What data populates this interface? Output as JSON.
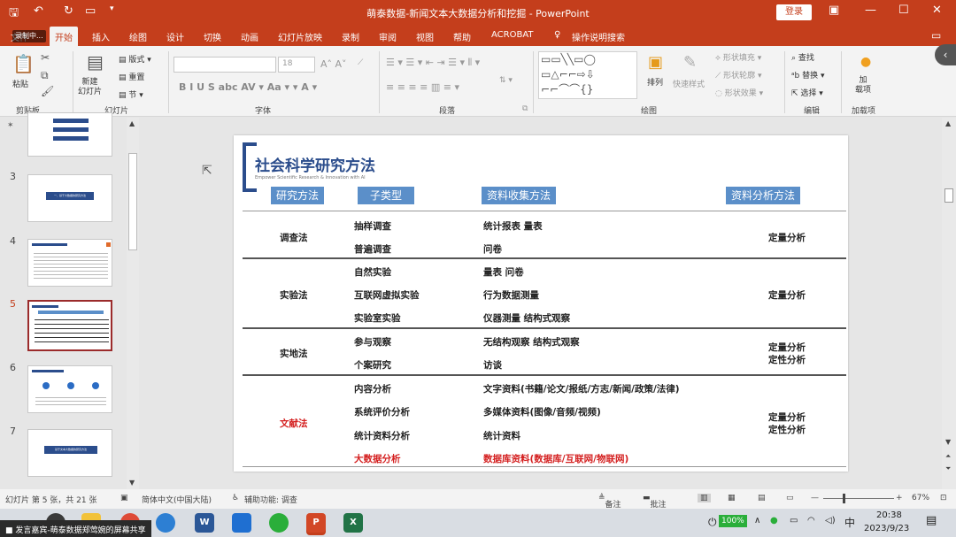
{
  "window": {
    "title": "萌泰数据-新闻文本大数据分析和挖掘  -  PowerPoint",
    "login": "登录",
    "recording_badge": "录制中..."
  },
  "tabs": [
    "文件",
    "开始",
    "插入",
    "绘图",
    "设计",
    "切换",
    "动画",
    "幻灯片放映",
    "录制",
    "审阅",
    "视图",
    "帮助",
    "ACROBAT",
    "操作说明搜索"
  ],
  "active_tab": "开始",
  "ribbon": {
    "clipboard": {
      "paste": "粘贴",
      "group": "剪贴板"
    },
    "slides": {
      "new_slide": "新建\n幻灯片",
      "layout": "版式",
      "reset": "重置",
      "section": "节",
      "group": "幻灯片"
    },
    "font": {
      "font_size": "18",
      "group": "字体"
    },
    "paragraph": {
      "group": "段落"
    },
    "drawing": {
      "arrange": "排列",
      "quick_styles": "快速样式",
      "fill": "形状填充",
      "outline": "形状轮廓",
      "effects": "形状效果",
      "group": "绘图"
    },
    "editing": {
      "find": "查找",
      "replace": "替换",
      "select": "选择",
      "group": "编辑"
    },
    "addins": {
      "label": "加\n载项",
      "group": "加载项"
    }
  },
  "thumbnails": [
    {
      "num": "3",
      "caption": "一、基于大数据的研究方法"
    },
    {
      "num": "4",
      "caption": ""
    },
    {
      "num": "5",
      "caption": ""
    },
    {
      "num": "6",
      "caption": ""
    },
    {
      "num": "7",
      "caption": "基于文本大数据的研究方法"
    }
  ],
  "slide": {
    "title": "社会科学研究方法",
    "subtitle": "Empower Scientific Research & Innovation with AI",
    "headers": [
      "研究方法",
      "子类型",
      "资料收集方法",
      "资料分析方法"
    ],
    "rows": [
      {
        "method": "调查法",
        "subs": [
          "抽样调查",
          "普遍调查"
        ],
        "collect": [
          "统计报表  量表",
          "问卷"
        ],
        "analysis": [
          "定量分析"
        ]
      },
      {
        "method": "实验法",
        "subs": [
          "自然实验",
          "互联网虚拟实验",
          "实验室实验"
        ],
        "collect": [
          "量表  问卷",
          "行为数据测量",
          "仪器测量    结构式观察"
        ],
        "analysis": [
          "定量分析"
        ]
      },
      {
        "method": "实地法",
        "subs": [
          "参与观察",
          "个案研究"
        ],
        "collect": [
          "无结构观察    结构式观察",
          "访谈"
        ],
        "analysis": [
          "定量分析",
          "定性分析"
        ]
      },
      {
        "method": "文献法",
        "subs": [
          "内容分析",
          "系统评价分析",
          "统计资料分析",
          "大数据分析"
        ],
        "collect": [
          "文字资料(书籍/论文/报纸/方志/新闻/政策/法律)",
          "多媒体资料(图像/音频/视频)",
          "统计资料",
          "数据库资料(数据库/互联网/物联网)"
        ],
        "analysis": [
          "定量分析",
          "定性分析"
        ]
      }
    ]
  },
  "status": {
    "slide_info": "幻灯片 第 5 张，共 21 张",
    "language": "简体中文(中国大陆)",
    "accessibility": "辅助功能: 调查",
    "notes": "备注",
    "comments": "批注",
    "zoom": "67%"
  },
  "taskbar": {
    "sharing": "发言嘉宾-萌泰数据郑莺婉的屏幕共享",
    "battery": "100%",
    "ime": "中",
    "time": "20:38",
    "date": "2023/9/23"
  },
  "colors": {
    "accent": "#c43e1c",
    "header_blue": "#5b8fc9",
    "red_text": "#d42020"
  }
}
